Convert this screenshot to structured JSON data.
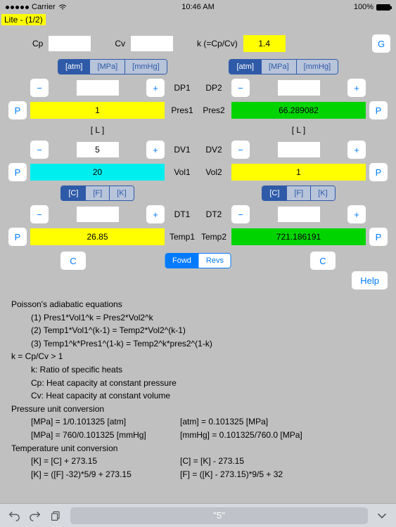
{
  "status": {
    "carrier": "Carrier",
    "time": "10:46 AM",
    "battery_pct": "100%"
  },
  "lite_tag": "Lite - (1/2)",
  "top": {
    "cp_label": "Cp",
    "cp_value": "",
    "cv_label": "Cv",
    "cv_value": "",
    "k_label": "k (=Cp/Cv)",
    "k_value": "1.4",
    "g_button": "G"
  },
  "pressure_units_left": [
    "[atm]",
    "[MPa]",
    "[mmHg]"
  ],
  "pressure_units_right": [
    "[atm]",
    "[MPa]",
    "[mmHg]"
  ],
  "temp_units_left": [
    "[C]",
    "[F]",
    "[K]"
  ],
  "temp_units_right": [
    "[C]",
    "[F]",
    "[K]"
  ],
  "minus": "−",
  "plus": "+",
  "p_btn": "P",
  "c_btn": "C",
  "help_btn": "Help",
  "dir_seg": [
    "Fowd",
    "Revs"
  ],
  "vol_unit": "[ L ]",
  "rows": {
    "dp1": {
      "label": "DP1",
      "input": ""
    },
    "dp2": {
      "label": "DP2",
      "input": ""
    },
    "pres1": {
      "label": "Pres1",
      "value": "1"
    },
    "pres2": {
      "label": "Pres2",
      "value": "66.289082"
    },
    "dv1": {
      "label": "DV1",
      "input": "5"
    },
    "dv2": {
      "label": "DV2",
      "input": ""
    },
    "vol1": {
      "label": "Vol1",
      "value": "20"
    },
    "vol2": {
      "label": "Vol2",
      "value": "1"
    },
    "dt1": {
      "label": "DT1",
      "input": ""
    },
    "dt2": {
      "label": "DT2",
      "input": ""
    },
    "temp1": {
      "label": "Temp1",
      "value": "26.85"
    },
    "temp2": {
      "label": "Temp2",
      "value": "721.186191"
    }
  },
  "notes": {
    "h1": "Poisson's adiabatic equations",
    "e1": "(1) Pres1*Vol1^k = Pres2*Vol2^k",
    "e2": "(2) Temp1*Vol1^(k-1) = Temp2*Vol2^(k-1)",
    "e3": "(3) Temp1^k*Pres1^(1-k) = Temp2^k*pres2^(1-k)",
    "h2": "k = Cp/Cv > 1",
    "k1": "k: Ratio of specific heats",
    "k2": "Cp: Heat capacity at constant pressure",
    "k3": "Cv: Heat capacity at constant volume",
    "h3": "Pressure unit conversion",
    "p1a": "[MPa] = 1/0.101325 [atm]",
    "p1b": "[atm] = 0.101325 [MPa]",
    "p2a": "[MPa] = 760/0.101325 [mmHg]",
    "p2b": "[mmHg] = 0.101325/760.0 [MPa]",
    "h4": "Temperature unit conversion",
    "t1a": "[K] = [C] + 273.15",
    "t1b": "[C] = [K] - 273.15",
    "t2a": "[K] = ([F] -32)*5/9 + 273.15",
    "t2b": "[F] = ([K] - 273.15)*9/5 + 32"
  },
  "bottom_input": "\"5\""
}
